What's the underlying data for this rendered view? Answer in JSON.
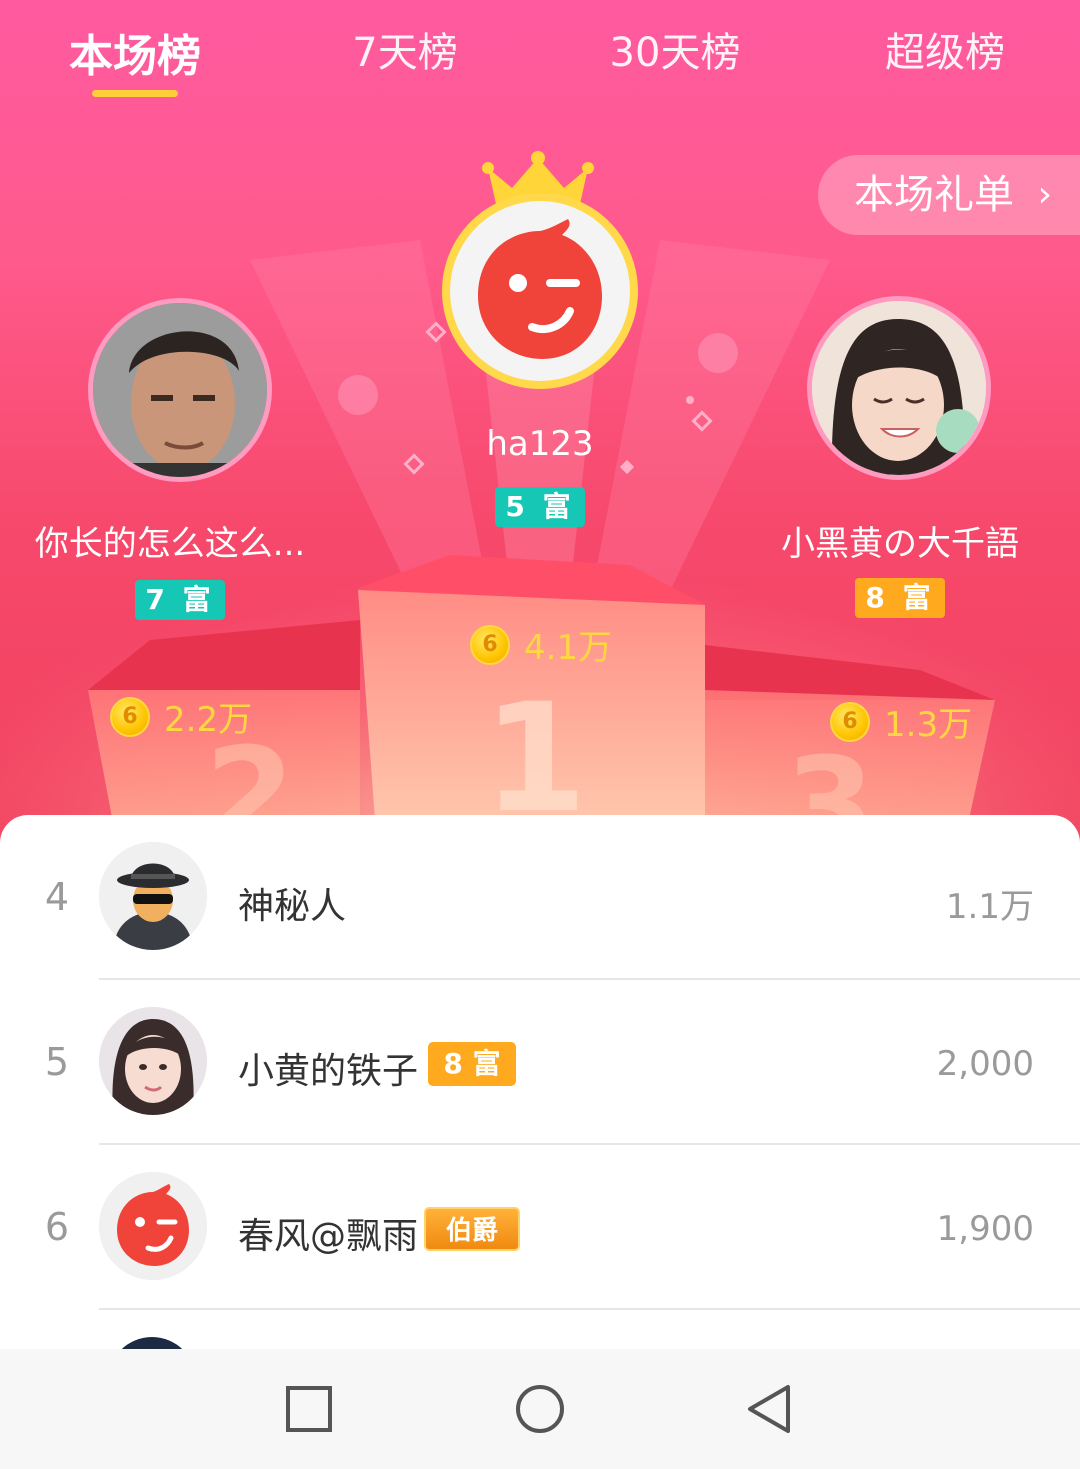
{
  "tabs": [
    {
      "label": "本场榜",
      "active": true
    },
    {
      "label": "7天榜",
      "active": false
    },
    {
      "label": "30天榜",
      "active": false
    },
    {
      "label": "超级榜",
      "active": false
    }
  ],
  "gift_list_button": {
    "label": "本场礼单",
    "icon": "chevron-right-icon"
  },
  "podium": {
    "first": {
      "rank": 1,
      "name": "ha123",
      "badge": "5 富",
      "badge_color": "#16c7b6",
      "score": "4.1万"
    },
    "second": {
      "rank": 2,
      "name": "你长的怎么这么...",
      "badge": "7 富",
      "badge_color": "#16c7b6",
      "score": "2.2万"
    },
    "third": {
      "rank": 3,
      "name": "小黑黄の大千語",
      "badge": "8 富",
      "badge_color": "#ffaa1e",
      "score": "1.3万"
    }
  },
  "coin_symbol": "6",
  "list": [
    {
      "rank": "4",
      "name": "神秘人",
      "value": "1.1万",
      "badge": "",
      "avatar": "mystery-man-avatar"
    },
    {
      "rank": "5",
      "name": "小黄的铁子",
      "value": "2,000",
      "badge": "8 富",
      "avatar": "girl-avatar"
    },
    {
      "rank": "6",
      "name": "春风@飘雨",
      "value": "1,900",
      "badge": "伯爵",
      "avatar": "default-red-avatar"
    }
  ],
  "nav": [
    "recents-square-icon",
    "home-circle-icon",
    "back-triangle-icon"
  ],
  "colors": {
    "accent_yellow": "#ffcf3a",
    "hero_pink": "#ff5a8c",
    "teal_badge": "#16c7b6",
    "orange_badge": "#ffaa1e"
  }
}
